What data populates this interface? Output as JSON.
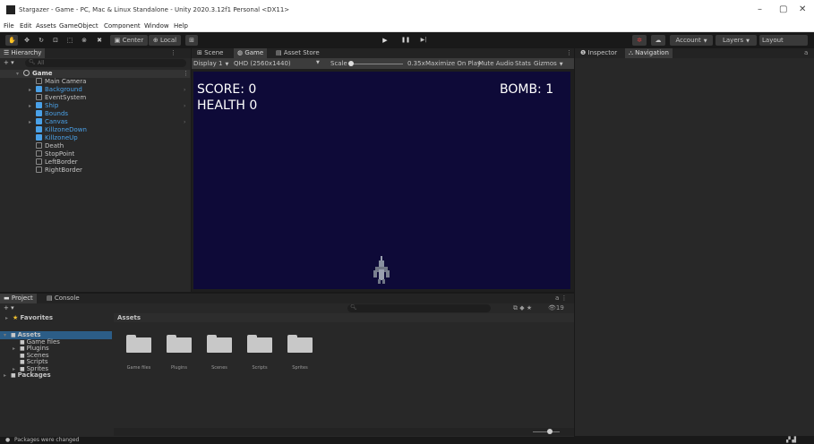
{
  "window": {
    "title": "Stargazer - Game - PC, Mac & Linux Standalone - Unity 2020.3.12f1 Personal <DX11>",
    "controls": {
      "minimize": "–",
      "maximize": "▢",
      "close": "✕"
    }
  },
  "menu": [
    "File",
    "Edit",
    "Assets",
    "GameObject",
    "Component",
    "Window",
    "Help"
  ],
  "toolbar": {
    "pivot_label": "Center",
    "space_label": "Local",
    "play_glyph": "▶",
    "pause_glyph": "❚❚",
    "step_glyph": "▶|",
    "account_label": "Account",
    "layers_label": "Layers",
    "layout_label": "Layout"
  },
  "hierarchy": {
    "tab": "Hierarchy",
    "add": "+ ▾",
    "search_placeholder": "All",
    "scene": "Game",
    "items": [
      {
        "name": "Main Camera",
        "kind": "go",
        "fold": ""
      },
      {
        "name": "Background",
        "kind": "prefab",
        "fold": "▸"
      },
      {
        "name": "EventSystem",
        "kind": "go",
        "fold": ""
      },
      {
        "name": "Ship",
        "kind": "prefab",
        "fold": "▸"
      },
      {
        "name": "Bounds",
        "kind": "prefab",
        "fold": ""
      },
      {
        "name": "Canvas",
        "kind": "prefab",
        "fold": "▸"
      },
      {
        "name": "KillzoneDown",
        "kind": "prefab",
        "fold": ""
      },
      {
        "name": "KillzoneUp",
        "kind": "prefab",
        "fold": ""
      },
      {
        "name": "Death",
        "kind": "go",
        "fold": ""
      },
      {
        "name": "StopPoint",
        "kind": "go",
        "fold": ""
      },
      {
        "name": "LeftBorder",
        "kind": "go",
        "fold": ""
      },
      {
        "name": "RightBorder",
        "kind": "go",
        "fold": ""
      }
    ]
  },
  "center_tabs": {
    "scene": "Scene",
    "game": "Game",
    "asset_store": "Asset Store"
  },
  "game_toolbar": {
    "display": "Display 1",
    "resolution": "QHD (2560x1440)",
    "scale_label": "Scale",
    "scale_value": "0.35x",
    "maximize": "Maximize On Play",
    "mute": "Mute Audio",
    "stats": "Stats",
    "gizmos": "Gizmos"
  },
  "hud": {
    "score": "SCORE: 0",
    "health": "HEALTH 0",
    "bomb": "BOMB: 1"
  },
  "right_tabs": {
    "inspector": "Inspector",
    "navigation": "Navigation"
  },
  "project": {
    "tab_project": "Project",
    "tab_console": "Console",
    "add": "+ ▾",
    "count": "19",
    "favorites": "Favorites",
    "breadcrumb": "Assets",
    "tree": [
      {
        "name": "Assets",
        "level": 0,
        "fold": "▾",
        "selected": true
      },
      {
        "name": "Game files",
        "level": 1,
        "fold": ""
      },
      {
        "name": "Plugins",
        "level": 1,
        "fold": "▸"
      },
      {
        "name": "Scenes",
        "level": 1,
        "fold": ""
      },
      {
        "name": "Scripts",
        "level": 1,
        "fold": ""
      },
      {
        "name": "Sprites",
        "level": 1,
        "fold": "▸"
      },
      {
        "name": "Packages",
        "level": 0,
        "fold": "▸"
      }
    ],
    "folders": [
      "Game files",
      "Plugins",
      "Scenes",
      "Scripts",
      "Sprites"
    ]
  },
  "status": {
    "message": "Packages were changed"
  },
  "colors": {
    "game_bg": "#0e0a38",
    "prefab": "#4aa1e8",
    "selection": "#2c5d87"
  }
}
